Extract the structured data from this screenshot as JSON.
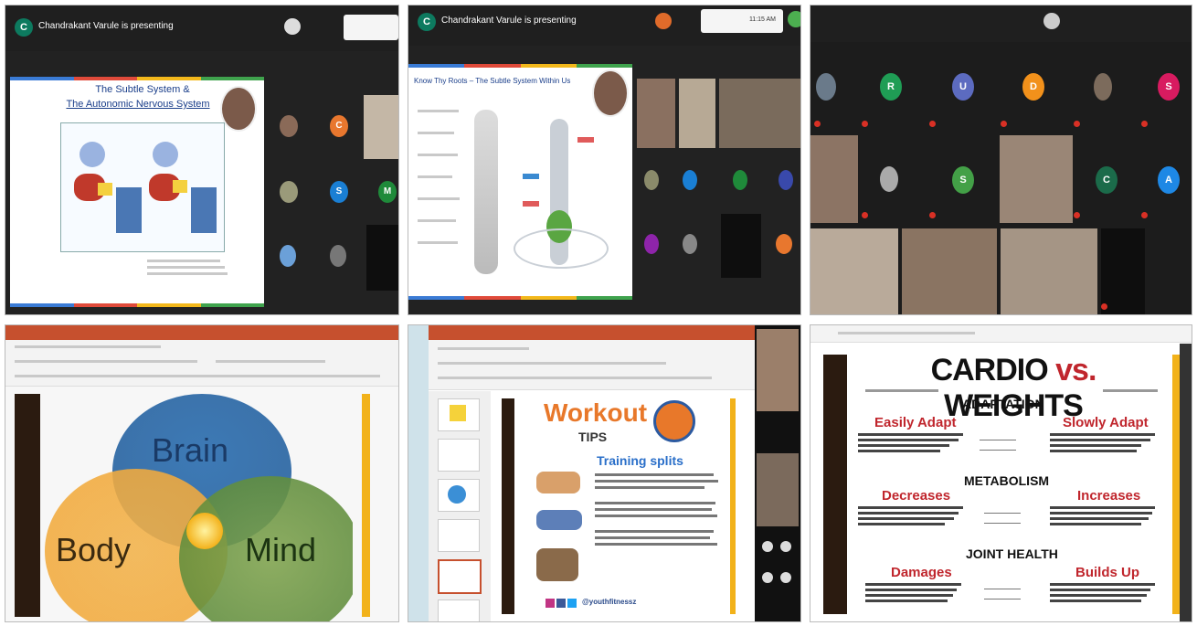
{
  "panel1": {
    "presenting": "Chandrakant Varule is presenting",
    "slide_title_1": "The Subtle System &",
    "slide_title_2": "The Autonomic Nervous System",
    "tile_letters": [
      "C",
      "S",
      "M"
    ]
  },
  "panel2": {
    "presenting": "Chandrakant Varule is presenting",
    "slide_title": "Know Thy Roots – The Subtle System Within Us",
    "clock": "11:15 AM"
  },
  "panel3": {
    "tile_letters": [
      "R",
      "U",
      "D",
      "S",
      "S",
      "C",
      "A"
    ]
  },
  "panel4": {
    "circle_brain": "Brain",
    "circle_body": "Body",
    "circle_mind": "Mind"
  },
  "panel5": {
    "workout": "Workout",
    "tips": "TIPS",
    "training": "Training splits",
    "handle": "@youthfitnessz"
  },
  "panel6": {
    "title_left": "CARDIO",
    "title_vs": "vs.",
    "title_right": "WEIGHTS",
    "adaptation": "ADAPTATION",
    "easily": "Easily Adapt",
    "slowly": "Slowly Adapt",
    "metabolism": "METABOLISM",
    "decreases": "Decreases",
    "increases": "Increases",
    "joint": "JOINT HEALTH",
    "damages": "Damages",
    "builds": "Builds Up"
  },
  "colors": {
    "meet_dark": "#1f1f1f",
    "ppt_red": "#c6502e",
    "gold": "#f2b21a",
    "workout_orange": "#e8782a",
    "weights_red": "#c0262d"
  }
}
